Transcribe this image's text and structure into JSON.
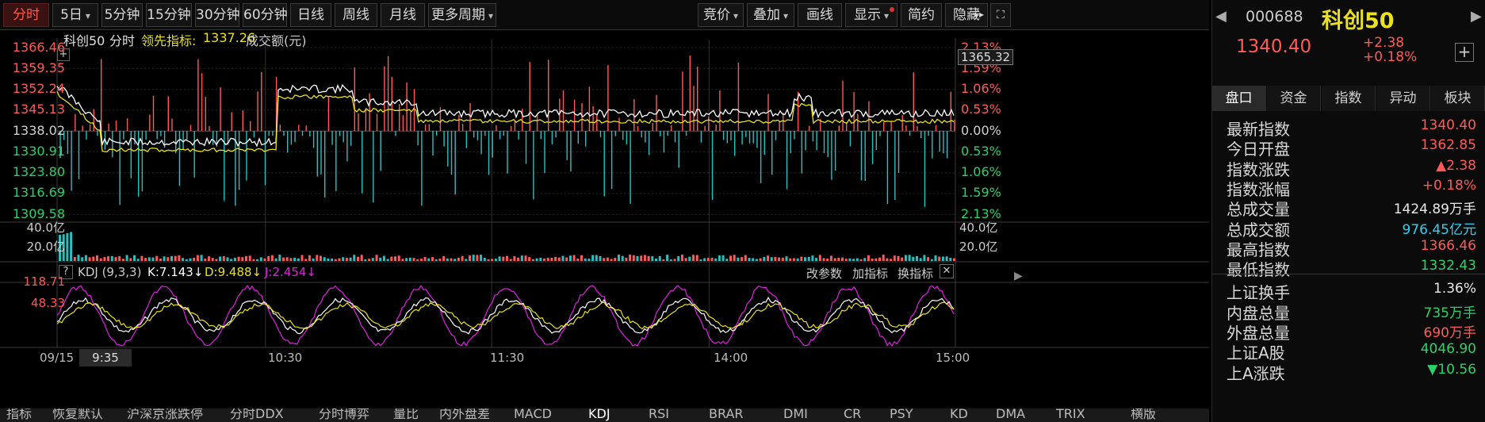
{
  "toolbar": {
    "items": [
      "分时",
      "5日",
      "5分钟",
      "15分钟",
      "30分钟",
      "60分钟",
      "日线",
      "周线",
      "月线",
      "更多周期"
    ],
    "right_items": [
      "竞价",
      "叠加",
      "画线",
      "显示",
      "简约",
      "隐藏"
    ],
    "active": "分时"
  },
  "chart": {
    "header": {
      "name": "科创50",
      "mode": "分时",
      "lead_label": "领先指标:",
      "lead_value": "1337.26",
      "volume_label": "成交额(元)"
    },
    "price_ticks": [
      "1366.46",
      "1359.35",
      "1352.24",
      "1345.13",
      "1338.02",
      "1330.91",
      "1323.80",
      "1316.69",
      "1309.58"
    ],
    "pct_ticks": [
      "2.13%",
      "1.59%",
      "1.06%",
      "0.53%",
      "0.00%",
      "0.53%",
      "1.06%",
      "1.59%",
      "2.13%"
    ],
    "current_price_tag": "1365.32",
    "volume_ticks": [
      "40.0亿",
      "20.0亿"
    ],
    "kdj": {
      "label": "KDJ (9,3,3)",
      "k": "K:7.143↓",
      "d": "D:9.488↓",
      "j": "J:2.454↓",
      "ticks": [
        "118.71",
        "48.33"
      ],
      "tools": [
        "改参数",
        "加指标",
        "换指标"
      ]
    },
    "time_axis": {
      "start": "09/15",
      "cursor": "9:35",
      "labels": [
        "10:30",
        "11:30",
        "14:00",
        "15:00"
      ]
    },
    "colors": {
      "price": "#ffffff",
      "lead": "#e8e020",
      "up": "#ff5a5a",
      "down": "#2ac0c0",
      "k": "#ffffff",
      "d": "#e8e020",
      "j": "#e020e0"
    }
  },
  "panel": {
    "code": "000688",
    "name": "科创50",
    "price": "1340.40",
    "change": "+2.38",
    "change_pct": "+0.18%",
    "tabs": [
      "盘口",
      "资金",
      "指数",
      "异动",
      "板块"
    ],
    "rows": [
      {
        "k": "最新指数",
        "v": "1340.40",
        "c": "up"
      },
      {
        "k": "今日开盘",
        "v": "1362.85",
        "c": "up"
      },
      {
        "k": "指数涨跌",
        "v": "▲2.38",
        "c": "up"
      },
      {
        "k": "指数涨幅",
        "v": "+0.18%",
        "c": "up"
      },
      {
        "k": "总成交量",
        "v": "1424.89万手",
        "c": "white"
      },
      {
        "k": "总成交额",
        "v": "976.45亿元",
        "c": "cyan"
      },
      {
        "k": "最高指数",
        "v": "1366.46",
        "c": "up"
      },
      {
        "k": "最低指数",
        "v": "1332.43",
        "c": "dn"
      },
      {
        "k": "上证换手",
        "v": "1.36%",
        "c": "white"
      },
      {
        "k": "内盘总量",
        "v": "735万手",
        "c": "dn"
      },
      {
        "k": "外盘总量",
        "v": "690万手",
        "c": "up"
      },
      {
        "k": "上证A股",
        "v": "4046.90",
        "c": "dn"
      },
      {
        "k": "上A涨跌",
        "v": "▼10.56",
        "c": "dn"
      }
    ]
  },
  "bottom_tabs": [
    "指标",
    "恢复默认",
    "沪深京涨跌停",
    "分时DDX",
    "分时博弈",
    "量比",
    "内外盘差",
    "MACD",
    "KDJ",
    "RSI",
    "BRAR",
    "DMI",
    "CR",
    "PSY",
    "KD",
    "DMA",
    "TRIX",
    "横版"
  ]
}
